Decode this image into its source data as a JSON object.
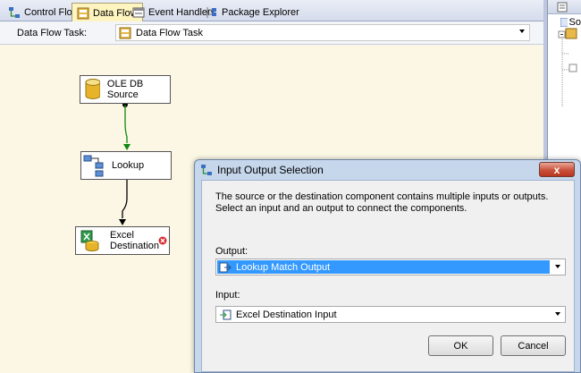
{
  "tabs": [
    {
      "label": "Control Flow",
      "icon": "control-flow-icon",
      "active": false
    },
    {
      "label": "Data Flow",
      "icon": "data-flow-icon",
      "active": true
    },
    {
      "label": "Event Handlers",
      "icon": "event-handlers-icon",
      "active": false
    },
    {
      "label": "Package Explorer",
      "icon": "package-explorer-icon",
      "active": false
    }
  ],
  "task": {
    "label": "Data Flow Task:",
    "selected": "Data Flow Task"
  },
  "components": [
    {
      "label": "OLE DB Source",
      "icon": "database-icon"
    },
    {
      "label": "Lookup",
      "icon": "lookup-icon"
    },
    {
      "label_lines": [
        "Excel",
        "Destination"
      ],
      "icon": "excel-icon",
      "error_icon": "error-icon"
    }
  ],
  "right_panel": {
    "text": "So"
  },
  "dialog": {
    "title": "Input Output Selection",
    "close_label": "x",
    "description": "The source or the destination component contains multiple inputs or outputs. Select an input and an output to connect the components.",
    "output_label": "Output:",
    "output_value": "Lookup Match Output",
    "input_label": "Input:",
    "input_value": "Excel Destination Input",
    "ok_label": "OK",
    "cancel_label": "Cancel"
  },
  "colors": {
    "canvas": "#fbf7e4",
    "selection": "#3399ff",
    "success_path": "#118811"
  }
}
